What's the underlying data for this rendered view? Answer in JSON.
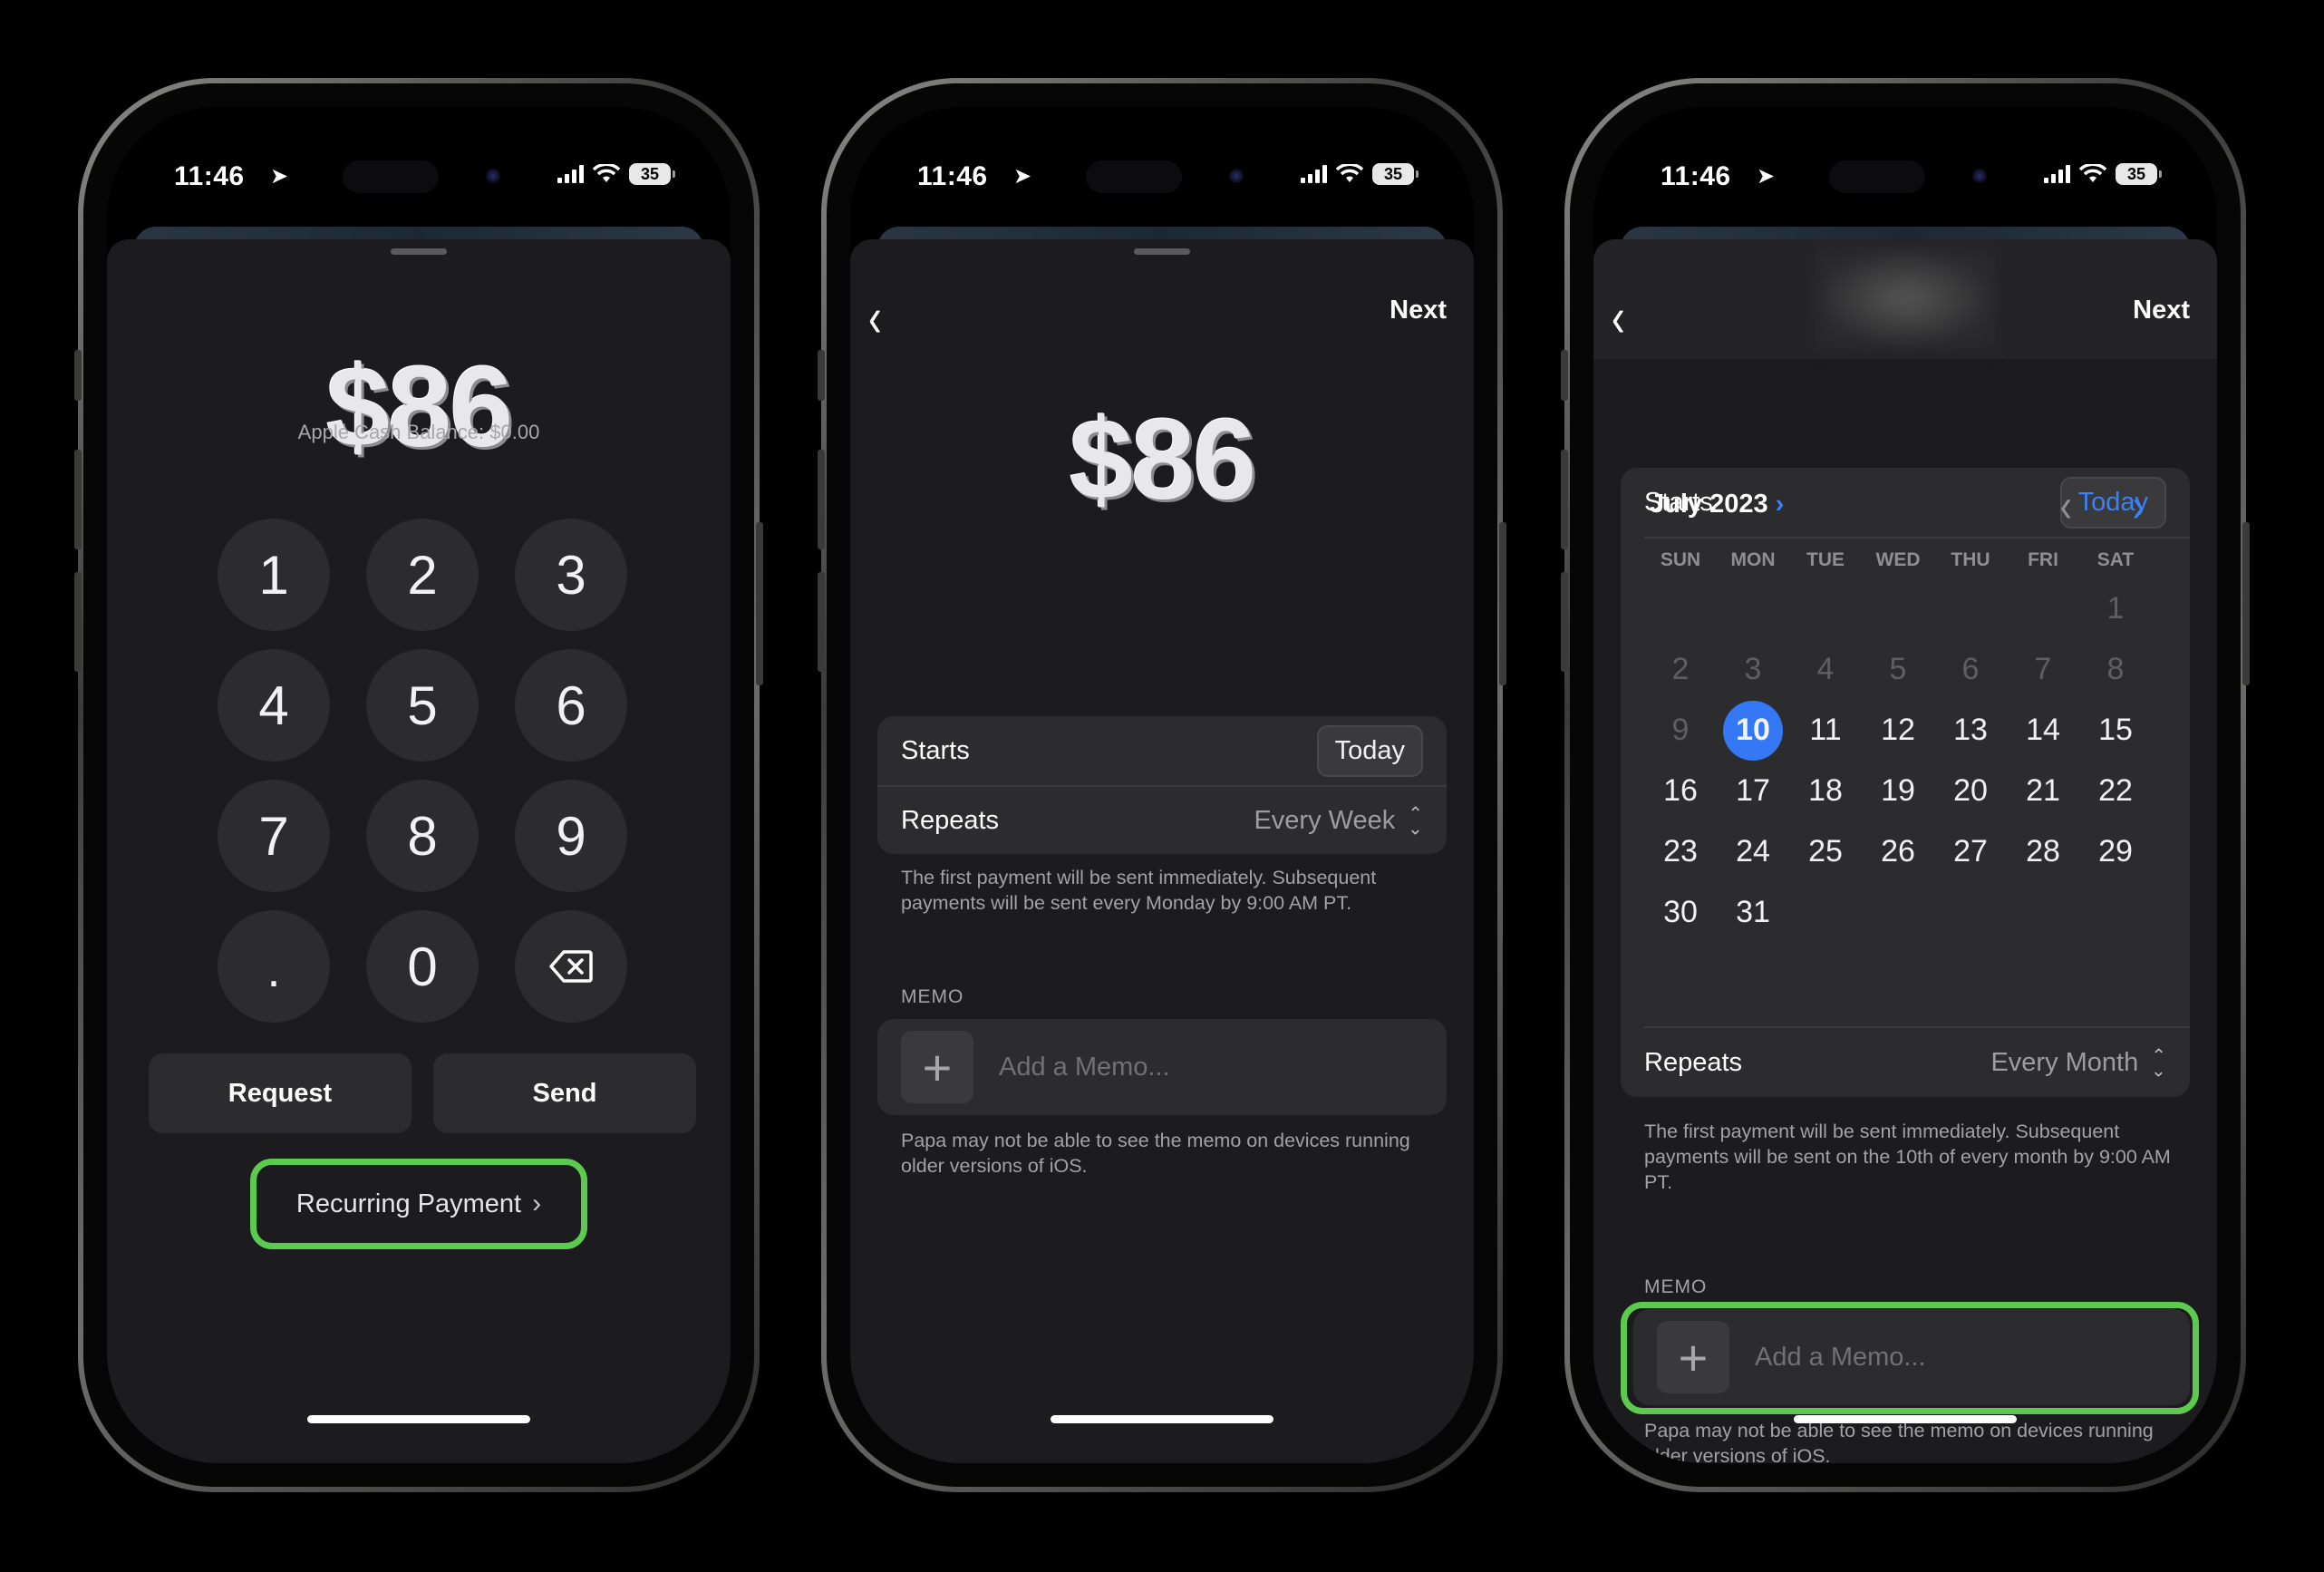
{
  "status": {
    "time": "11:46",
    "battery": "35"
  },
  "phone1": {
    "amount": "$86",
    "balance": "Apple Cash Balance: $0.00",
    "keys": [
      "1",
      "2",
      "3",
      "4",
      "5",
      "6",
      "7",
      "8",
      "9",
      ".",
      "0",
      "⌫"
    ],
    "request_label": "Request",
    "send_label": "Send",
    "recurring_label": "Recurring Payment"
  },
  "phone2": {
    "next_label": "Next",
    "amount": "$86",
    "starts_label": "Starts",
    "starts_value": "Today",
    "repeats_label": "Repeats",
    "repeats_value": "Every Week",
    "note": "The first payment will be sent immediately. Subsequent payments will be sent every Monday by 9:00 AM PT.",
    "memo_label": "MEMO",
    "memo_placeholder": "Add a Memo...",
    "memo_note": "Papa may not be able to see the memo on devices running older versions of iOS."
  },
  "phone3": {
    "next_label": "Next",
    "starts_label": "Starts",
    "starts_value": "Today",
    "month": "July 2023",
    "weekdays": [
      "SUN",
      "MON",
      "TUE",
      "WED",
      "THU",
      "FRI",
      "SAT"
    ],
    "selected_day": "10",
    "repeats_label": "Repeats",
    "repeats_value": "Every Month",
    "note": "The first payment will be sent immediately. Subsequent payments will be sent on the 10th of every month by 9:00 AM PT.",
    "memo_label": "MEMO",
    "memo_placeholder": "Add a Memo...",
    "memo_note": "Papa may not be able to see the memo on devices running older versions of iOS."
  },
  "colors": {
    "accent": "#3478f6",
    "highlight": "#5cc94f",
    "sheet": "#1c1c1e",
    "cell": "#2c2c2e"
  }
}
